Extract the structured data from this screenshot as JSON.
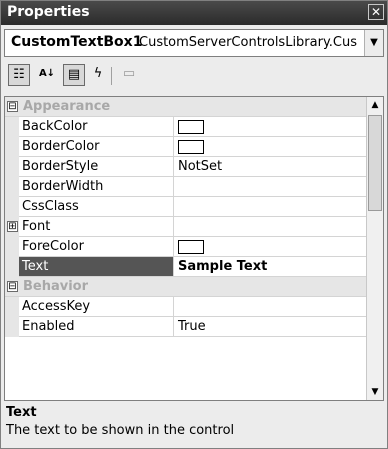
{
  "window": {
    "title": "Properties",
    "close_glyph": "✕"
  },
  "object_selector": {
    "name": "CustomTextBox1",
    "type": "CustomServerControlsLibrary.Cus",
    "dropdown_glyph": "▼"
  },
  "toolbar": {
    "categorized_glyph": "☷",
    "alphabetical_glyph": "A↓",
    "properties_glyph": "▤",
    "events_glyph": "ϟ",
    "pages_glyph": "▭"
  },
  "grid": {
    "rows": [
      {
        "kind": "category",
        "label": "Appearance",
        "expander": "⊟"
      },
      {
        "kind": "prop",
        "name": "BackColor",
        "value": "",
        "swatch": true
      },
      {
        "kind": "prop",
        "name": "BorderColor",
        "value": "",
        "swatch": true
      },
      {
        "kind": "prop",
        "name": "BorderStyle",
        "value": "NotSet"
      },
      {
        "kind": "prop",
        "name": "BorderWidth",
        "value": ""
      },
      {
        "kind": "prop",
        "name": "CssClass",
        "value": ""
      },
      {
        "kind": "prop",
        "name": "Font",
        "value": "",
        "expander": "⊞"
      },
      {
        "kind": "prop",
        "name": "ForeColor",
        "value": "",
        "swatch": true
      },
      {
        "kind": "prop",
        "name": "Text",
        "value": "Sample Text",
        "selected": true
      },
      {
        "kind": "category",
        "label": "Behavior",
        "expander": "⊟"
      },
      {
        "kind": "prop",
        "name": "AccessKey",
        "value": ""
      },
      {
        "kind": "prop",
        "name": "Enabled",
        "value": "True"
      }
    ],
    "scroll_up_glyph": "▲",
    "scroll_down_glyph": "▼"
  },
  "description": {
    "title": "Text",
    "text": "The text to be shown in the control"
  }
}
